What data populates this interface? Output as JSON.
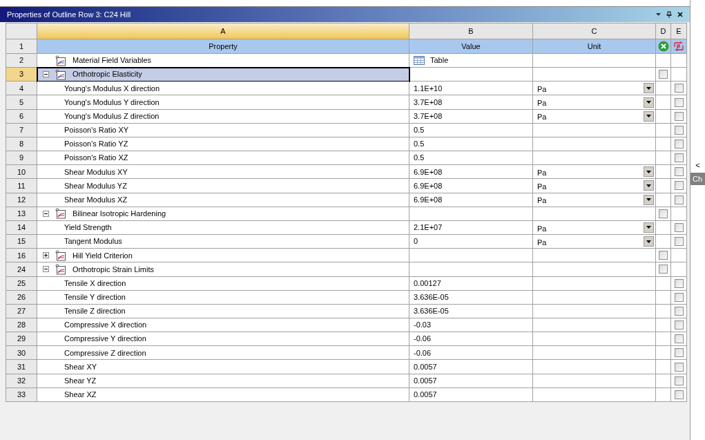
{
  "panel": {
    "title": "Properties of Outline Row 3: C24 Hill"
  },
  "columns": [
    {
      "letter": "A",
      "selected": true
    },
    {
      "letter": "B",
      "selected": false
    },
    {
      "letter": "C",
      "selected": false
    },
    {
      "letter": "D",
      "selected": false
    },
    {
      "letter": "E",
      "selected": false
    }
  ],
  "header": {
    "number": "1",
    "cells": [
      "Property",
      "Value",
      "Unit"
    ]
  },
  "rows": [
    {
      "number": "2",
      "kind": "table",
      "label": "Material Field Variables",
      "value": "Table",
      "selected": false
    },
    {
      "number": "3",
      "kind": "group",
      "label": "Orthotropic Elasticity",
      "expanded": true,
      "checked": false,
      "selected": true
    },
    {
      "number": "4",
      "kind": "property",
      "label": "Young's Modulus X direction",
      "value": "1.1E+10",
      "unit": "Pa",
      "checked": false,
      "selected": false
    },
    {
      "number": "5",
      "kind": "property",
      "label": "Young's Modulus Y direction",
      "value": "3.7E+08",
      "unit": "Pa",
      "checked": false,
      "selected": false
    },
    {
      "number": "6",
      "kind": "property",
      "label": "Young's Modulus Z direction",
      "value": "3.7E+08",
      "unit": "Pa",
      "checked": false,
      "selected": false
    },
    {
      "number": "7",
      "kind": "property",
      "label": "Poisson's Ratio XY",
      "value": "0.5",
      "checked": false,
      "selected": false
    },
    {
      "number": "8",
      "kind": "property",
      "label": "Poisson's Ratio YZ",
      "value": "0.5",
      "checked": false,
      "selected": false
    },
    {
      "number": "9",
      "kind": "property",
      "label": "Poisson's Ratio XZ",
      "value": "0.5",
      "checked": false,
      "selected": false
    },
    {
      "number": "10",
      "kind": "property",
      "label": "Shear Modulus XY",
      "value": "6.9E+08",
      "unit": "Pa",
      "checked": false,
      "selected": false
    },
    {
      "number": "11",
      "kind": "property",
      "label": "Shear Modulus YZ",
      "value": "6.9E+08",
      "unit": "Pa",
      "checked": false,
      "selected": false
    },
    {
      "number": "12",
      "kind": "property",
      "label": "Shear Modulus XZ",
      "value": "6.9E+08",
      "unit": "Pa",
      "checked": false,
      "selected": false
    },
    {
      "number": "13",
      "kind": "group",
      "label": "Bilinear Isotropic Hardening",
      "expanded": true,
      "checked": false,
      "selected": false
    },
    {
      "number": "14",
      "kind": "property",
      "label": "Yield Strength",
      "value": "2.1E+07",
      "unit": "Pa",
      "checked": false,
      "selected": false
    },
    {
      "number": "15",
      "kind": "property",
      "label": "Tangent Modulus",
      "value": "0",
      "unit": "Pa",
      "checked": false,
      "selected": false
    },
    {
      "number": "16",
      "kind": "group",
      "label": "Hill Yield Criterion",
      "expanded": false,
      "checked": false,
      "selected": false
    },
    {
      "number": "24",
      "kind": "group",
      "label": "Orthotropic Strain Limits",
      "expanded": true,
      "checked": false,
      "selected": false
    },
    {
      "number": "25",
      "kind": "property",
      "label": "Tensile X direction",
      "value": "0.00127",
      "checked": false,
      "selected": false
    },
    {
      "number": "26",
      "kind": "property",
      "label": "Tensile Y direction",
      "value": "3.636E-05",
      "checked": false,
      "selected": false
    },
    {
      "number": "27",
      "kind": "property",
      "label": "Tensile Z direction",
      "value": "3.636E-05",
      "checked": false,
      "selected": false
    },
    {
      "number": "28",
      "kind": "property",
      "label": "Compressive X direction",
      "value": "-0.03",
      "checked": false,
      "selected": false
    },
    {
      "number": "29",
      "kind": "property",
      "label": "Compressive Y direction",
      "value": "-0.06",
      "checked": false,
      "selected": false
    },
    {
      "number": "30",
      "kind": "property",
      "label": "Compressive Z direction",
      "value": "-0.06",
      "checked": false,
      "selected": false
    },
    {
      "number": "31",
      "kind": "property",
      "label": "Shear XY",
      "value": "0.0057",
      "checked": false,
      "selected": false
    },
    {
      "number": "32",
      "kind": "property",
      "label": "Shear YZ",
      "value": "0.0057",
      "checked": false,
      "selected": false
    },
    {
      "number": "33",
      "kind": "property",
      "label": "Shear XZ",
      "value": "0.0057",
      "checked": false,
      "selected": false
    }
  ],
  "side_panel": {
    "collapse": "<",
    "tab": "Ch"
  }
}
